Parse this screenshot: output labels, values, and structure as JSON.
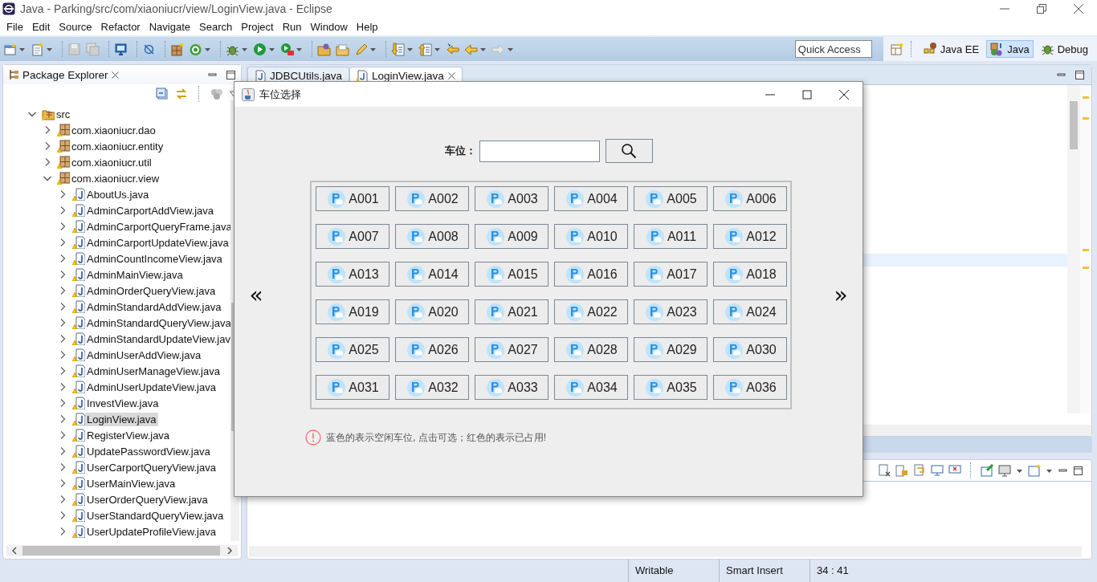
{
  "window": {
    "title": "Java - Parking/src/com/xiaoniucr/view/LoginView.java - Eclipse"
  },
  "menu": [
    "File",
    "Edit",
    "Source",
    "Refactor",
    "Navigate",
    "Search",
    "Project",
    "Run",
    "Window",
    "Help"
  ],
  "quick_access": {
    "placeholder": "Quick Access"
  },
  "perspectives": [
    {
      "label": "Java EE",
      "selected": false
    },
    {
      "label": "Java",
      "selected": true
    },
    {
      "label": "Debug",
      "selected": false
    }
  ],
  "package_explorer": {
    "title": "Package Explorer",
    "tree": [
      {
        "label": "src",
        "kind": "folder",
        "expanded": true,
        "selected": false,
        "children": [
          {
            "label": "com.xiaoniucr.dao",
            "kind": "package",
            "expanded": false,
            "selected": false
          },
          {
            "label": "com.xiaoniucr.entity",
            "kind": "package",
            "expanded": false,
            "selected": false
          },
          {
            "label": "com.xiaoniucr.util",
            "kind": "package",
            "expanded": false,
            "selected": false
          },
          {
            "label": "com.xiaoniucr.view",
            "kind": "package",
            "expanded": true,
            "selected": false,
            "children": [
              {
                "label": "AboutUs.java",
                "kind": "file",
                "expanded": false,
                "selected": false
              },
              {
                "label": "AdminCarportAddView.java",
                "kind": "file",
                "expanded": false,
                "selected": false
              },
              {
                "label": "AdminCarportQueryFrame.java",
                "kind": "file",
                "expanded": false,
                "selected": false
              },
              {
                "label": "AdminCarportUpdateView.java",
                "kind": "file",
                "expanded": false,
                "selected": false
              },
              {
                "label": "AdminCountIncomeView.java",
                "kind": "file",
                "expanded": false,
                "selected": false
              },
              {
                "label": "AdminMainView.java",
                "kind": "file",
                "expanded": false,
                "selected": false
              },
              {
                "label": "AdminOrderQueryView.java",
                "kind": "file",
                "expanded": false,
                "selected": false
              },
              {
                "label": "AdminStandardAddView.java",
                "kind": "file",
                "expanded": false,
                "selected": false
              },
              {
                "label": "AdminStandardQueryView.java",
                "kind": "file",
                "expanded": false,
                "selected": false
              },
              {
                "label": "AdminStandardUpdateView.jav",
                "kind": "file",
                "expanded": false,
                "selected": false
              },
              {
                "label": "AdminUserAddView.java",
                "kind": "file",
                "expanded": false,
                "selected": false
              },
              {
                "label": "AdminUserManageView.java",
                "kind": "file",
                "expanded": false,
                "selected": false
              },
              {
                "label": "AdminUserUpdateView.java",
                "kind": "file",
                "expanded": false,
                "selected": false
              },
              {
                "label": "InvestView.java",
                "kind": "file",
                "expanded": false,
                "selected": false
              },
              {
                "label": "LoginView.java",
                "kind": "file",
                "expanded": false,
                "selected": true
              },
              {
                "label": "RegisterView.java",
                "kind": "file",
                "expanded": false,
                "selected": false
              },
              {
                "label": "UpdatePasswordView.java",
                "kind": "file",
                "expanded": false,
                "selected": false
              },
              {
                "label": "UserCarportQueryView.java",
                "kind": "file",
                "expanded": false,
                "selected": false
              },
              {
                "label": "UserMainView.java",
                "kind": "file",
                "expanded": false,
                "selected": false
              },
              {
                "label": "UserOrderQueryView.java",
                "kind": "file",
                "expanded": false,
                "selected": false
              },
              {
                "label": "UserStandardQueryView.java",
                "kind": "file",
                "expanded": false,
                "selected": false
              },
              {
                "label": "UserUpdateProfileView.java",
                "kind": "file",
                "expanded": false,
                "selected": false
              }
            ]
          }
        ]
      }
    ]
  },
  "editor_tabs": [
    {
      "label": "JDBCUtils.java",
      "selected": false
    },
    {
      "label": "LoginView.java",
      "selected": true
    }
  ],
  "dialog": {
    "title": "车位选择",
    "search_label": "车位：",
    "prev": "«",
    "next": "»",
    "spots": [
      {
        "label": "A001",
        "occupied": false
      },
      {
        "label": "A002",
        "occupied": false
      },
      {
        "label": "A003",
        "occupied": false
      },
      {
        "label": "A004",
        "occupied": false
      },
      {
        "label": "A005",
        "occupied": false
      },
      {
        "label": "A006",
        "occupied": false
      },
      {
        "label": "A007",
        "occupied": false
      },
      {
        "label": "A008",
        "occupied": false
      },
      {
        "label": "A009",
        "occupied": false
      },
      {
        "label": "A010",
        "occupied": false
      },
      {
        "label": "A011",
        "occupied": false
      },
      {
        "label": "A012",
        "occupied": false
      },
      {
        "label": "A013",
        "occupied": false
      },
      {
        "label": "A014",
        "occupied": false
      },
      {
        "label": "A015",
        "occupied": false
      },
      {
        "label": "A016",
        "occupied": false
      },
      {
        "label": "A017",
        "occupied": false
      },
      {
        "label": "A018",
        "occupied": false
      },
      {
        "label": "A019",
        "occupied": false
      },
      {
        "label": "A020",
        "occupied": false
      },
      {
        "label": "A021",
        "occupied": false
      },
      {
        "label": "A022",
        "occupied": false
      },
      {
        "label": "A023",
        "occupied": false
      },
      {
        "label": "A024",
        "occupied": false
      },
      {
        "label": "A025",
        "occupied": false
      },
      {
        "label": "A026",
        "occupied": false
      },
      {
        "label": "A027",
        "occupied": false
      },
      {
        "label": "A028",
        "occupied": false
      },
      {
        "label": "A029",
        "occupied": false
      },
      {
        "label": "A030",
        "occupied": false
      },
      {
        "label": "A031",
        "occupied": false
      },
      {
        "label": "A032",
        "occupied": false
      },
      {
        "label": "A033",
        "occupied": false
      },
      {
        "label": "A034",
        "occupied": false
      },
      {
        "label": "A035",
        "occupied": false
      },
      {
        "label": "A036",
        "occupied": false
      }
    ],
    "note": "蓝色的表示空闲车位, 点击可选；红色的表示已占用!"
  },
  "status_bar": [
    "Writable",
    "Smart Insert",
    "34 : 41"
  ]
}
